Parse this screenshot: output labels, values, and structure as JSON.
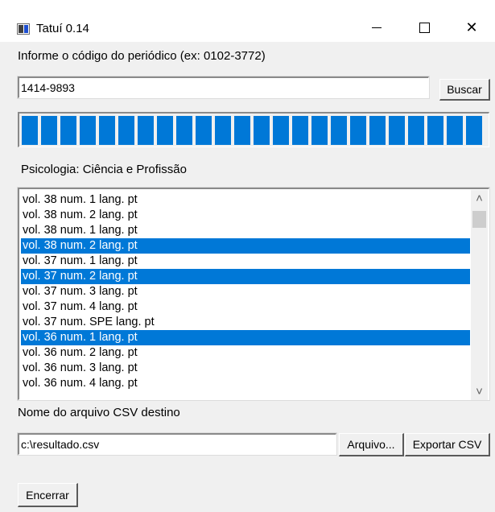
{
  "window": {
    "title": "Tatuí 0.14",
    "minimize_icon": "minimize-icon",
    "maximize_icon": "maximize-icon",
    "close_icon": "close-icon",
    "close_glyph": "✕"
  },
  "search": {
    "prompt": "Informe o código do periódico (ex: 0102-3772)",
    "code_value": "1414-9893",
    "button_label": "Buscar"
  },
  "progress": {
    "fraction": 1.0,
    "color": "#0078d7"
  },
  "journal": {
    "name": "Psicologia: Ciência e Profissão"
  },
  "issues": {
    "items": [
      {
        "label": "vol. 38 num. 1 lang. pt",
        "selected": false
      },
      {
        "label": "vol. 38 num. 2 lang. pt",
        "selected": false
      },
      {
        "label": "vol. 38 num. 1 lang. pt",
        "selected": false
      },
      {
        "label": "vol. 38 num. 2 lang. pt",
        "selected": true
      },
      {
        "label": "vol. 37 num. 1 lang. pt",
        "selected": false
      },
      {
        "label": "vol. 37 num. 2 lang. pt",
        "selected": true
      },
      {
        "label": "vol. 37 num. 3 lang. pt",
        "selected": false
      },
      {
        "label": "vol. 37 num. 4 lang. pt",
        "selected": false
      },
      {
        "label": "vol. 37 num. SPE lang. pt",
        "selected": false
      },
      {
        "label": "vol. 36 num. 1 lang. pt",
        "selected": true
      },
      {
        "label": "vol. 36 num. 2 lang. pt",
        "selected": false
      },
      {
        "label": "vol. 36 num. 3 lang. pt",
        "selected": false
      },
      {
        "label": "vol. 36 num. 4 lang. pt",
        "selected": false
      }
    ],
    "selection_color": "#0078d7",
    "scroll_up_glyph": "˄",
    "scroll_down_glyph": "˅"
  },
  "export": {
    "prompt": "Nome do arquivo CSV destino",
    "file_value": "c:\\resultado.csv",
    "file_button_label": "Arquivo...",
    "export_button_label": "Exportar CSV"
  },
  "footer": {
    "exit_button_label": "Encerrar"
  }
}
